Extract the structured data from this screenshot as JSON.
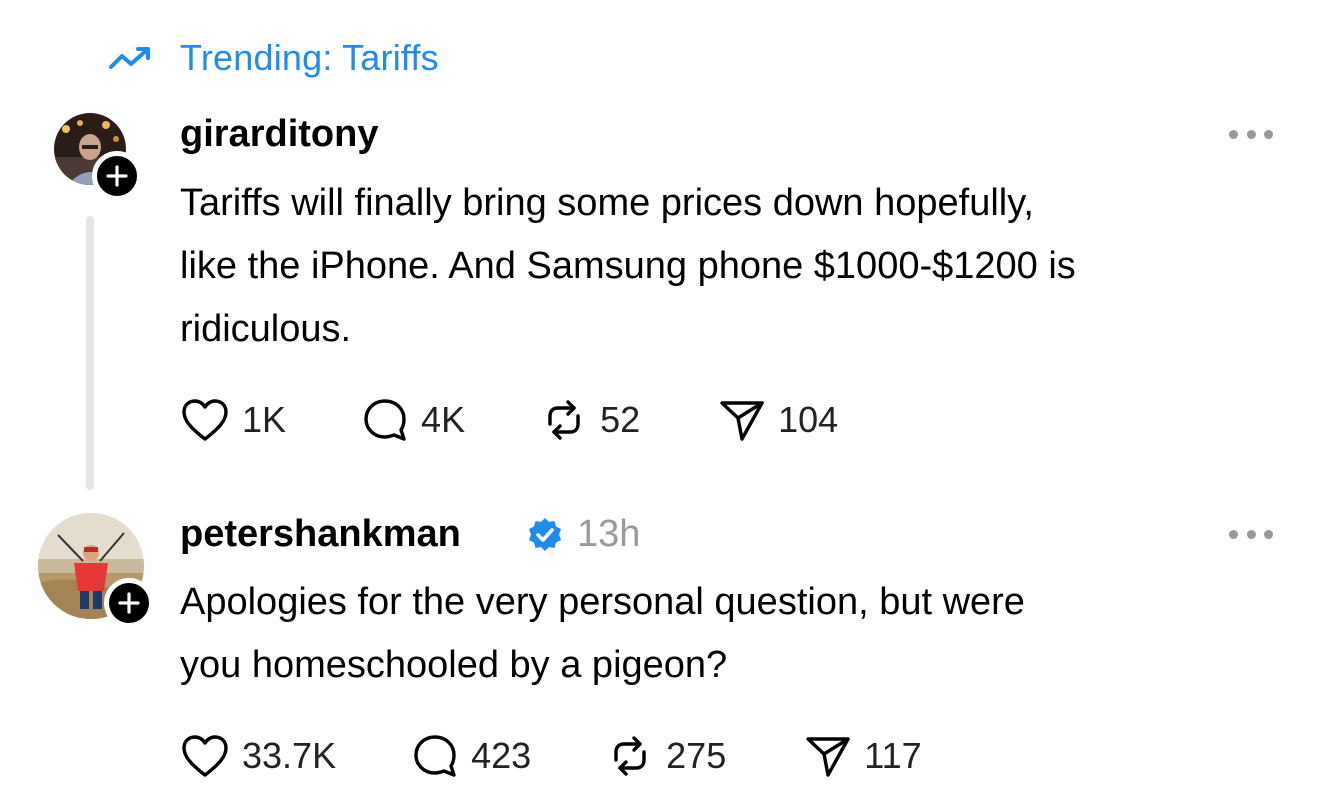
{
  "trending": {
    "label": "Trending: Tariffs",
    "icon": "trending-up-icon",
    "color": "#1d8cf0"
  },
  "posts": [
    {
      "username": "girarditony",
      "text_lines": [
        "Tariffs will finally bring some prices down hopefully,",
        "like the iPhone. And Samsung phone $1000-$1200 is",
        "ridiculous."
      ],
      "actions": {
        "likes": "1K",
        "replies": "4K",
        "reposts": "52",
        "shares": "104"
      }
    },
    {
      "username": "petershankman",
      "verified": true,
      "time": "13h",
      "text_lines": [
        "Apologies for the very personal question, but were",
        "you homeschooled by a pigeon?"
      ],
      "actions": {
        "likes": "33.7K",
        "replies": "423",
        "reposts": "275",
        "shares": "117"
      }
    }
  ],
  "colors": {
    "verified": "#1d8cf0",
    "muted": "#9a9a9a",
    "thread_line": "#e6e6e6"
  }
}
